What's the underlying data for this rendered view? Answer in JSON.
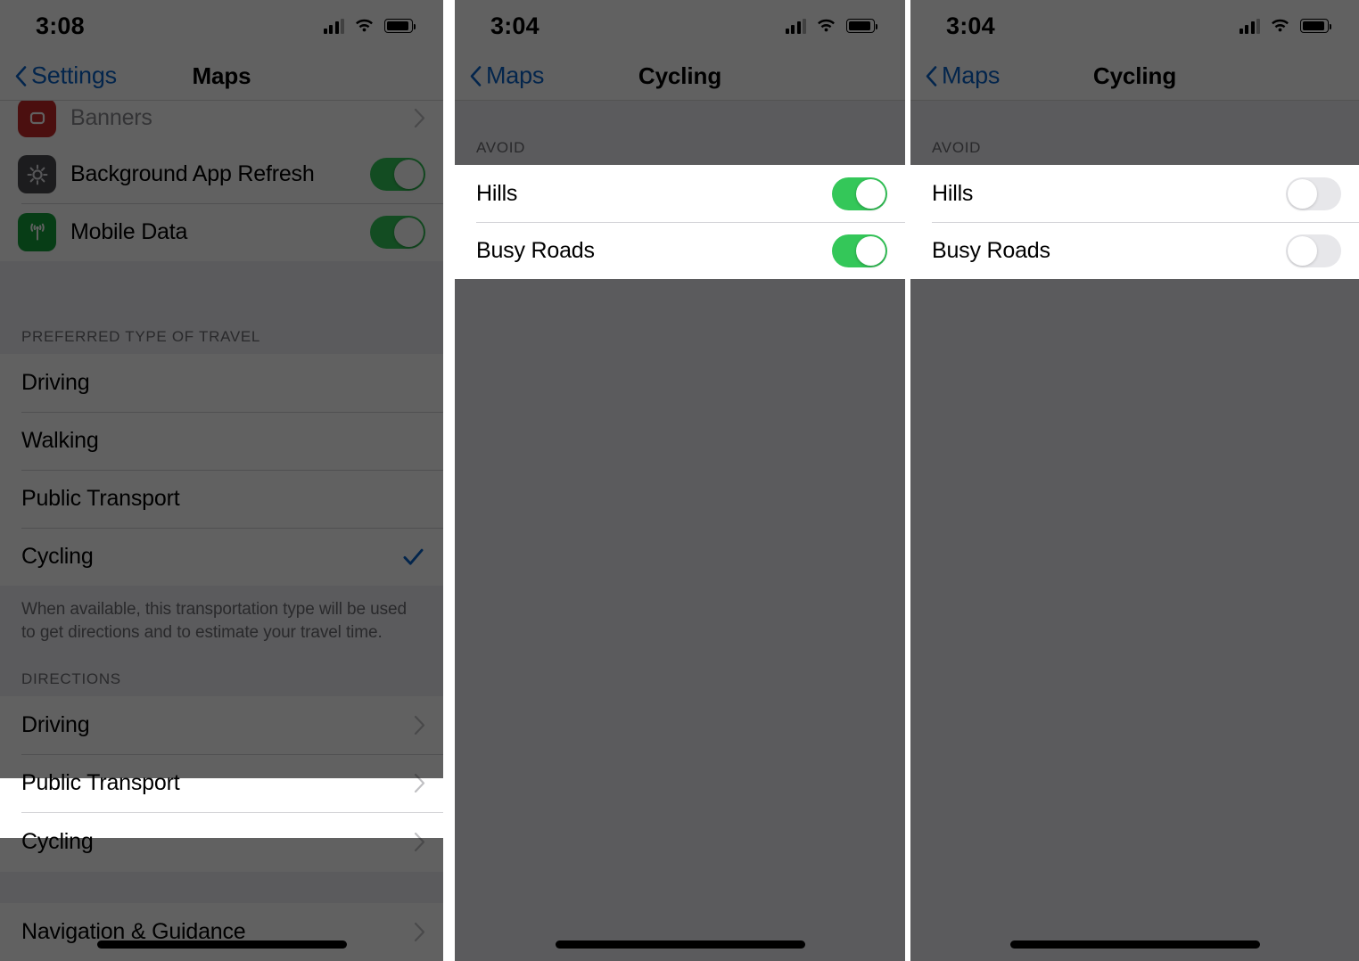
{
  "meta": {
    "accent_blue": "#0a63c9",
    "toggle_on_green": "#34c759",
    "toggle_off_gray": "#e7e7ea",
    "group_bg": "#efeff4",
    "scrim": "rgba(0,0,0,0.62)"
  },
  "panels": [
    {
      "id": "maps-settings",
      "status": {
        "time": "3:08",
        "signal_icon": "cellular-signal-icon",
        "wifi_icon": "wifi-icon",
        "battery_icon": "battery-icon"
      },
      "nav": {
        "back_label": "Settings",
        "back_icon": "chevron-left-icon",
        "title": "Maps"
      },
      "partial_row": {
        "label": "Banners",
        "icon": "notifications-app-icon",
        "accessory": "chevron-right-icon"
      },
      "toggle_rows": [
        {
          "label": "Background App Refresh",
          "icon": "gear-app-icon",
          "state": "on"
        },
        {
          "label": "Mobile Data",
          "icon": "cellular-app-icon",
          "state": "on"
        }
      ],
      "travel_section": {
        "header": "PREFERRED TYPE OF TRAVEL",
        "rows": [
          {
            "label": "Driving",
            "checked": false
          },
          {
            "label": "Walking",
            "checked": false
          },
          {
            "label": "Public Transport",
            "checked": false
          },
          {
            "label": "Cycling",
            "checked": true
          }
        ],
        "footnote": "When available, this transportation type will be used to get directions and to estimate your travel time."
      },
      "directions_section": {
        "header": "DIRECTIONS",
        "rows": [
          {
            "label": "Driving",
            "accessory": "chevron-right-icon",
            "highlighted": false
          },
          {
            "label": "Public Transport",
            "accessory": "chevron-right-icon",
            "highlighted": false
          },
          {
            "label": "Cycling",
            "accessory": "chevron-right-icon",
            "highlighted": true
          }
        ]
      },
      "nav_guidance_section": {
        "rows": [
          {
            "label": "Navigation & Guidance",
            "accessory": "chevron-right-icon"
          }
        ]
      }
    },
    {
      "id": "cycling-toggles-on",
      "status": {
        "time": "3:04",
        "signal_icon": "cellular-signal-icon",
        "wifi_icon": "wifi-icon",
        "battery_icon": "battery-icon"
      },
      "nav": {
        "back_label": "Maps",
        "back_icon": "chevron-left-icon",
        "title": "Cycling"
      },
      "avoid_section": {
        "header": "AVOID",
        "rows": [
          {
            "label": "Hills",
            "state": "on"
          },
          {
            "label": "Busy Roads",
            "state": "on"
          }
        ]
      }
    },
    {
      "id": "cycling-toggles-off",
      "status": {
        "time": "3:04",
        "signal_icon": "cellular-signal-icon",
        "wifi_icon": "wifi-icon",
        "battery_icon": "battery-icon"
      },
      "nav": {
        "back_label": "Maps",
        "back_icon": "chevron-left-icon",
        "title": "Cycling"
      },
      "avoid_section": {
        "header": "AVOID",
        "rows": [
          {
            "label": "Hills",
            "state": "off"
          },
          {
            "label": "Busy Roads",
            "state": "off"
          }
        ]
      }
    }
  ]
}
